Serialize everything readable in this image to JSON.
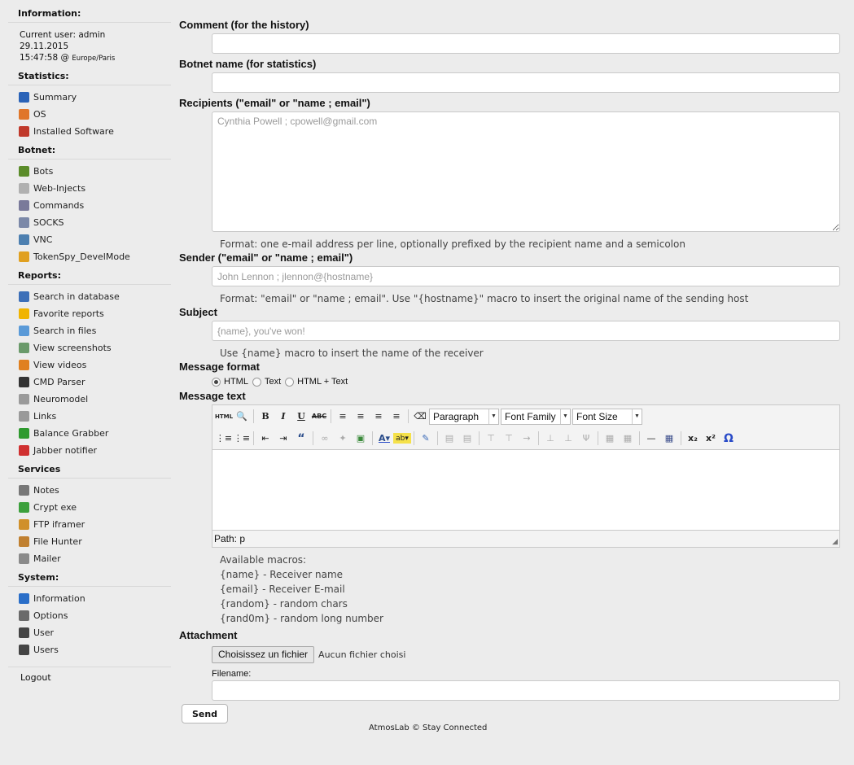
{
  "sidebar": {
    "info_title": "Information:",
    "current_user": "Current user: admin",
    "date": "29.11.2015",
    "time": "15:47:58 @",
    "timezone": "Europe/Paris",
    "sections": [
      {
        "title": "Statistics:",
        "items": [
          {
            "label": "Summary",
            "icon": "home-icon",
            "color": "#2a63b8"
          },
          {
            "label": "OS",
            "icon": "windows-icon",
            "color": "#e0762a"
          },
          {
            "label": "Installed Software",
            "icon": "software-icon",
            "color": "#c0392b"
          }
        ]
      },
      {
        "title": "Botnet:",
        "items": [
          {
            "label": "Bots",
            "icon": "user-icon",
            "color": "#5b8c2a"
          },
          {
            "label": "Web-Injects",
            "icon": "syringe-icon",
            "color": "#b0b0b0"
          },
          {
            "label": "Commands",
            "icon": "clipboard-icon",
            "color": "#7a7a9a"
          },
          {
            "label": "SOCKS",
            "icon": "socks-icon",
            "color": "#7b88a8"
          },
          {
            "label": "VNC",
            "icon": "monitor-icon",
            "color": "#4c7fb0"
          },
          {
            "label": "TokenSpy_DevelMode",
            "icon": "key-icon",
            "color": "#e0a020"
          }
        ]
      },
      {
        "title": "Reports:",
        "items": [
          {
            "label": "Search in database",
            "icon": "database-icon",
            "color": "#3c6fb8"
          },
          {
            "label": "Favorite reports",
            "icon": "star-icon",
            "color": "#f0b400"
          },
          {
            "label": "Search in files",
            "icon": "folder-icon",
            "color": "#5a9ad8"
          },
          {
            "label": "View screenshots",
            "icon": "screenshot-icon",
            "color": "#6a9a6a"
          },
          {
            "label": "View videos",
            "icon": "video-icon",
            "color": "#e08020"
          },
          {
            "label": "CMD Parser",
            "icon": "terminal-icon",
            "color": "#333333"
          },
          {
            "label": "Neuromodel",
            "icon": "neuro-icon",
            "color": "#9a9a9a"
          },
          {
            "label": "Links",
            "icon": "link-search-icon",
            "color": "#9a9a9a"
          },
          {
            "label": "Balance Grabber",
            "icon": "dollar-icon",
            "color": "#2f9a2f"
          },
          {
            "label": "Jabber notifier",
            "icon": "jabber-icon",
            "color": "#d03030"
          }
        ]
      },
      {
        "title": "Services",
        "items": [
          {
            "label": "Notes",
            "icon": "pen-icon",
            "color": "#777777"
          },
          {
            "label": "Crypt exe",
            "icon": "shield-icon",
            "color": "#3ca03c"
          },
          {
            "label": "FTP iframer",
            "icon": "ftp-icon",
            "color": "#d0902a"
          },
          {
            "label": "File Hunter",
            "icon": "file-hunter-icon",
            "color": "#c08030"
          },
          {
            "label": "Mailer",
            "icon": "mail-icon",
            "color": "#8a8a8a"
          }
        ]
      },
      {
        "title": "System:",
        "items": [
          {
            "label": "Information",
            "icon": "info-icon",
            "color": "#2a6ec8"
          },
          {
            "label": "Options",
            "icon": "options-icon",
            "color": "#6a6a6a"
          },
          {
            "label": "User",
            "icon": "user-icon",
            "color": "#444444"
          },
          {
            "label": "Users",
            "icon": "users-icon",
            "color": "#444444"
          }
        ]
      }
    ],
    "logout": "Logout"
  },
  "form": {
    "comment_label": "Comment (for the history)",
    "botnet_label": "Botnet name (for statistics)",
    "recipients_label": "Recipients (\"email\" or \"name ; email\")",
    "recipients_placeholder": "Cynthia Powell ; cpowell@gmail.com",
    "recipients_hint": "Format: one e-mail address per line, optionally prefixed by the recipient name and a semicolon",
    "sender_label": "Sender (\"email\" or \"name ; email\")",
    "sender_placeholder": "John Lennon ; jlennon@{hostname}",
    "sender_hint": "Format: \"email\" or \"name ; email\". Use \"{hostname}\" macro to insert the original name of the sending host",
    "subject_label": "Subject",
    "subject_placeholder": "{name}, you've won!",
    "subject_hint": "Use {name} macro to insert the name of the receiver",
    "format_label": "Message format",
    "format_options": [
      "HTML",
      "Text",
      "HTML + Text"
    ],
    "format_selected": "HTML",
    "message_label": "Message text",
    "editor": {
      "html_btn": "HTML",
      "paragraph": "Paragraph",
      "font_family": "Font Family",
      "font_size": "Font Size",
      "path": "Path: p"
    },
    "macros_title": "Available macros:",
    "macros": [
      "{name} - Receiver name",
      "{email} - Receiver E-mail",
      "{random} - random chars",
      "{rand0m} - random long number"
    ],
    "attachment_label": "Attachment",
    "file_button": "Choisissez un fichier",
    "file_none": "Aucun fichier choisi",
    "filename_label": "Filename:",
    "send_button": "Send"
  },
  "footer": "AtmosLab © Stay Connected"
}
